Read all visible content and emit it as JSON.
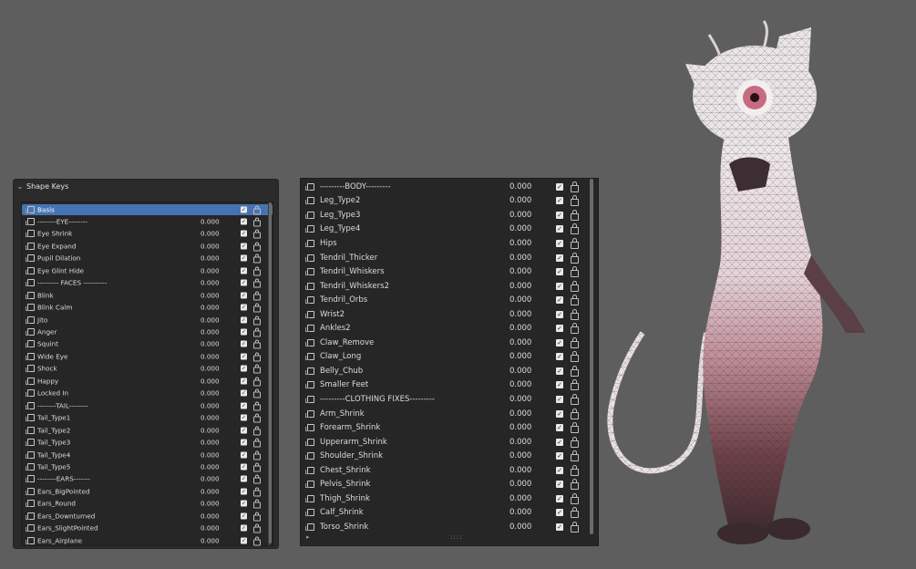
{
  "left_panel": {
    "title": "Shape Keys",
    "rows": [
      {
        "name": "Basis",
        "value": "",
        "selected": true
      },
      {
        "name": "--------EYE--------",
        "value": "0.000"
      },
      {
        "name": "Eye Shrink",
        "value": "0.000"
      },
      {
        "name": "Eye Expand",
        "value": "0.000"
      },
      {
        "name": "Pupil Dilation",
        "value": "0.000"
      },
      {
        "name": "Eye Glint Hide",
        "value": "0.000"
      },
      {
        "name": "--------- FACES ----------",
        "value": "0.000"
      },
      {
        "name": "Blink",
        "value": "0.000"
      },
      {
        "name": "Blink Calm",
        "value": "0.000"
      },
      {
        "name": "Jito",
        "value": "0.000"
      },
      {
        "name": "Anger",
        "value": "0.000"
      },
      {
        "name": "Squint",
        "value": "0.000"
      },
      {
        "name": "Wide Eye",
        "value": "0.000"
      },
      {
        "name": "Shock",
        "value": "0.000"
      },
      {
        "name": "Happy",
        "value": "0.000"
      },
      {
        "name": "Locked In",
        "value": "0.000"
      },
      {
        "name": "--------TAIL--------",
        "value": "0.000"
      },
      {
        "name": "Tail_Type1",
        "value": "0.000"
      },
      {
        "name": "Tail_Type2",
        "value": "0.000"
      },
      {
        "name": "Tail_Type3",
        "value": "0.000"
      },
      {
        "name": "Tail_Type4",
        "value": "0.000"
      },
      {
        "name": "Tail_Type5",
        "value": "0.000"
      },
      {
        "name": "--------EARS-------",
        "value": "0.000"
      },
      {
        "name": "Ears_BigPointed",
        "value": "0.000"
      },
      {
        "name": "Ears_Round",
        "value": "0.000"
      },
      {
        "name": "Ears_Downturned",
        "value": "0.000"
      },
      {
        "name": "Ears_SlightPointed",
        "value": "0.000"
      },
      {
        "name": "Ears_Airplane",
        "value": "0.000"
      }
    ]
  },
  "right_panel": {
    "rows": [
      {
        "name": "---------BODY---------",
        "value": "0.000"
      },
      {
        "name": "Leg_Type2",
        "value": "0.000"
      },
      {
        "name": "Leg_Type3",
        "value": "0.000"
      },
      {
        "name": "Leg_Type4",
        "value": "0.000"
      },
      {
        "name": "Hips",
        "value": "0.000"
      },
      {
        "name": "Tendril_Thicker",
        "value": "0.000"
      },
      {
        "name": "Tendril_Whiskers",
        "value": "0.000"
      },
      {
        "name": "Tendril_Whiskers2",
        "value": "0.000"
      },
      {
        "name": "Tendril_Orbs",
        "value": "0.000"
      },
      {
        "name": "Wrist2",
        "value": "0.000"
      },
      {
        "name": "Ankles2",
        "value": "0.000"
      },
      {
        "name": "Claw_Remove",
        "value": "0.000"
      },
      {
        "name": "Claw_Long",
        "value": "0.000"
      },
      {
        "name": "Belly_Chub",
        "value": "0.000"
      },
      {
        "name": "Smaller Feet",
        "value": "0.000"
      },
      {
        "name": "---------CLOTHING FIXES---------",
        "value": "0.000"
      },
      {
        "name": "Arm_Shrink",
        "value": "0.000"
      },
      {
        "name": "Forearm_Shrink",
        "value": "0.000"
      },
      {
        "name": "Upperarm_Shrink",
        "value": "0.000"
      },
      {
        "name": "Shoulder_Shrink",
        "value": "0.000"
      },
      {
        "name": "Chest_Shrink",
        "value": "0.000"
      },
      {
        "name": "Pelvis_Shrink",
        "value": "0.000"
      },
      {
        "name": "Thigh_Shrink",
        "value": "0.000"
      },
      {
        "name": "Calf_Shrink",
        "value": "0.000"
      },
      {
        "name": "Torso_Shrink",
        "value": "0.000"
      }
    ]
  },
  "colors": {
    "background": "#5e5e5e",
    "panel": "#2b2b2b",
    "list": "#262626",
    "selection": "#4674b2",
    "text": "#dcdcdc"
  },
  "icons": {
    "collapse": "chevron-down-icon",
    "shape_key": "shape-key-icon",
    "checkbox": "checkbox-checked-icon",
    "lock": "unlock-icon",
    "expand": "triangle-right-icon",
    "grip": "resize-grip-icon"
  }
}
